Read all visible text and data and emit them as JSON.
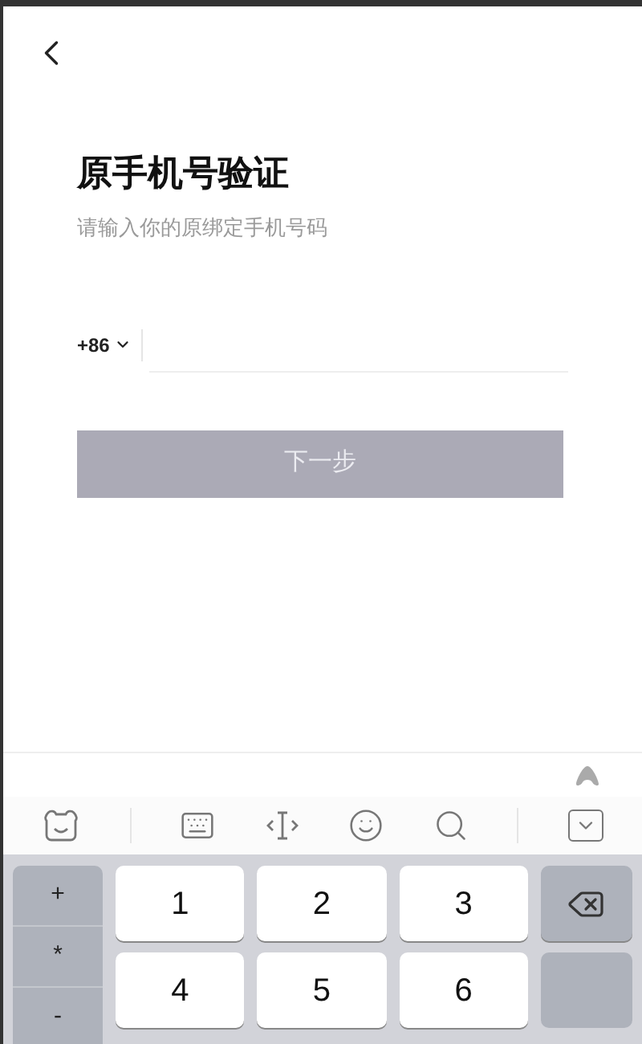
{
  "header": {
    "back": true
  },
  "title": "原手机号验证",
  "subtitle": "请输入你的原绑定手机号码",
  "phone": {
    "country_code": "+86"
  },
  "next_button": {
    "label": "下一步",
    "disabled": true
  },
  "keyboard": {
    "side_keys": [
      "+",
      "*",
      "-"
    ],
    "rows": [
      [
        "1",
        "2",
        "3"
      ],
      [
        "4",
        "5",
        "6"
      ]
    ]
  }
}
